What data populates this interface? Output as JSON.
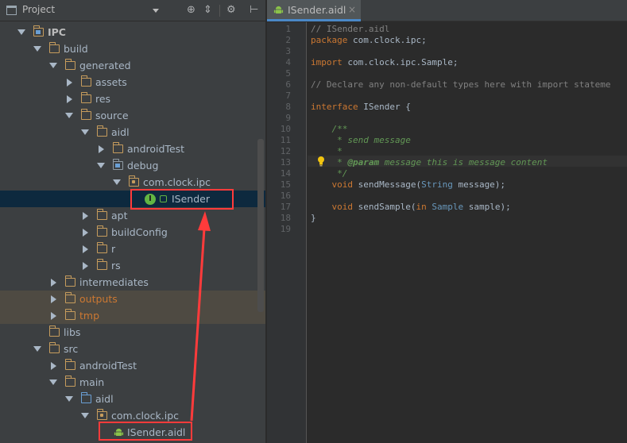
{
  "project_panel": {
    "title": "Project",
    "tree": [
      {
        "label": "IPC",
        "bold": true
      },
      {
        "label": "build"
      },
      {
        "label": "generated"
      },
      {
        "label": "assets"
      },
      {
        "label": "res"
      },
      {
        "label": "source"
      },
      {
        "label": "aidl"
      },
      {
        "label": "androidTest"
      },
      {
        "label": "debug"
      },
      {
        "label": "com.clock.ipc"
      },
      {
        "label": "ISender"
      },
      {
        "label": "apt"
      },
      {
        "label": "buildConfig"
      },
      {
        "label": "r"
      },
      {
        "label": "rs"
      },
      {
        "label": "intermediates"
      },
      {
        "label": "outputs"
      },
      {
        "label": "tmp"
      },
      {
        "label": "libs"
      },
      {
        "label": "src"
      },
      {
        "label": "androidTest"
      },
      {
        "label": "main"
      },
      {
        "label": "aidl"
      },
      {
        "label": "com.clock.ipc"
      },
      {
        "label": "ISender.aidl"
      }
    ],
    "badge_letter": "I"
  },
  "editor": {
    "tab": {
      "label": "ISender.aidl",
      "close": "×"
    },
    "line_numbers": [
      "1",
      "2",
      "3",
      "4",
      "5",
      "6",
      "7",
      "8",
      "9",
      "10",
      "11",
      "12",
      "13",
      "14",
      "15",
      "16",
      "17",
      "18",
      "19"
    ],
    "lines": {
      "l1": "// ISender.aidl",
      "l2_kw": "package",
      "l2_rest": " com.clock.ipc;",
      "l4_kw": "import",
      "l4_rest": " com.clock.ipc.Sample;",
      "l6": "// Declare any non-default types here with import stateme",
      "l8_kw": "interface",
      "l8_rest": " ISender {",
      "l10": "    /**",
      "l11": "     * send message",
      "l12": "     *",
      "l13_pre": "     * ",
      "l13_tag": "@param",
      "l13_rest": " message this is message content",
      "l14": "     */",
      "l15_kw": "    void",
      "l15_mid": " sendMessage(",
      "l15_type": "String",
      "l15_end": " message);",
      "l17_kw": "    void",
      "l17_mid": " sendSample(",
      "l17_in": "in",
      "l17_sp": " ",
      "l17_type": "Sample",
      "l17_end": " sample);",
      "l18": "}"
    }
  },
  "colors": {
    "annotation": "#ff3b3b",
    "selection": "#0d293e",
    "tab_underline": "#4a88c7"
  }
}
